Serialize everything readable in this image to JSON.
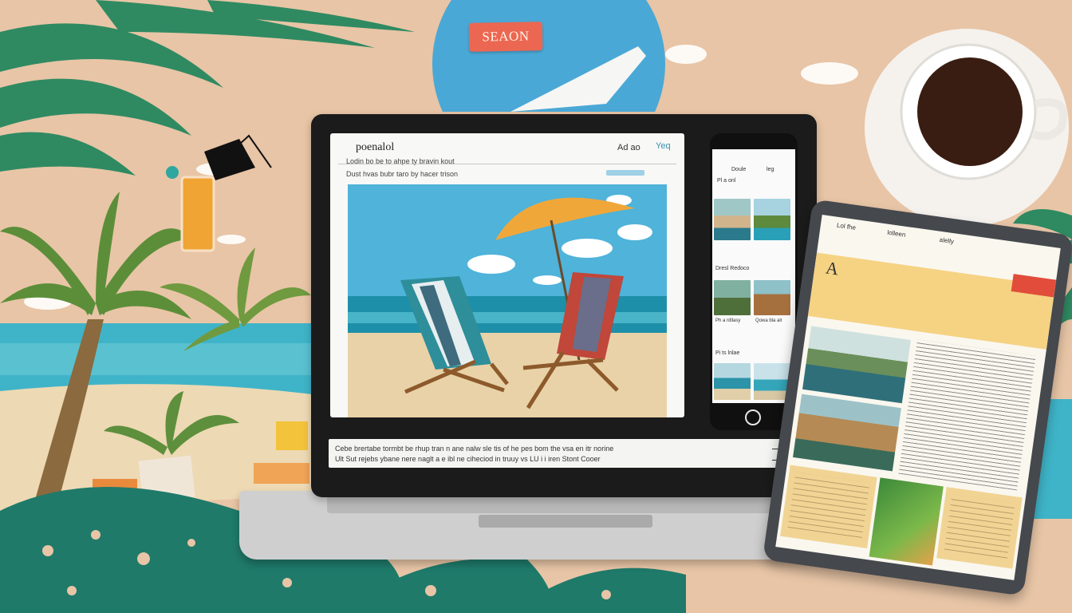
{
  "scene": {
    "hanging_sign": "SEAON",
    "colors": {
      "background": "#e8c5a6",
      "sea": "#3fb4c8",
      "sky": "#4fb3da",
      "sand": "#e9d2a8",
      "umbrella": "#f0a73a",
      "sign": "#ec6752",
      "palm": "#2f8a62"
    }
  },
  "laptop": {
    "site_title": "poenalol",
    "nav": [
      "Ad ao",
      "Yeq"
    ],
    "subtitle_1": "Lodin bo be to ahpe ty bravin kout",
    "subtitle_2": "Dust hvas bubr taro by hacer trison",
    "hero_image": "beach-chairs-umbrella",
    "caption": [
      "Cebe brertabe tormbt be rhup tran n ane nalw sle tis of he pes bom the vsa en itr norine",
      "Ult Sut rejebs ybane nere naglt a e ibl ne ciheciod in truuy vs LU i i iren Stont Cooer"
    ]
  },
  "phone": {
    "header": [
      "Doule",
      "leg"
    ],
    "tag": "Pl a onl",
    "sections": [
      "Dresl Redoco",
      "Pi ts lnlae"
    ],
    "thumb_labels": [
      "Ph a rdllasy",
      "Qowa bla alr"
    ]
  },
  "tablet": {
    "tabs": [
      "Lol fhe",
      "lolleen",
      "alelly"
    ],
    "initial": "A"
  }
}
